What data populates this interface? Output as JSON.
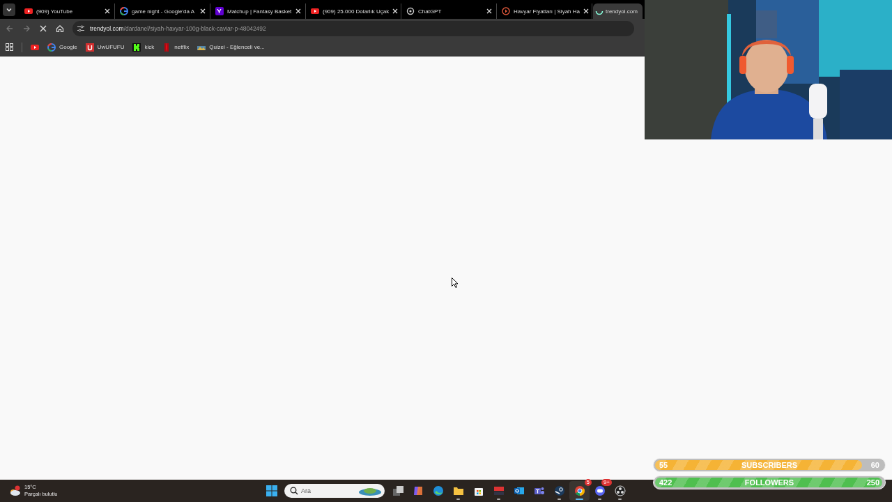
{
  "tabs": [
    {
      "title": "(909) YouTube",
      "kind": "youtube",
      "selected": false
    },
    {
      "title": "game night - Google'da A",
      "kind": "google",
      "selected": false
    },
    {
      "title": "Matchup | Fantasy Basket",
      "kind": "yahoo",
      "selected": false
    },
    {
      "title": "(909) 25.000 Dolarlık Uçak",
      "kind": "youtube",
      "selected": false
    },
    {
      "title": "ChatGPT",
      "kind": "chatgpt",
      "selected": false
    },
    {
      "title": "Havyar Fiyatları | Siyah Ha",
      "kind": "ring",
      "selected": false
    },
    {
      "title": "trendyol.com",
      "kind": "loading",
      "selected": true
    }
  ],
  "address": {
    "domain": "trendyol.com",
    "path": "/dardanel/siyah-havyar-100g-black-caviar-p-48042492"
  },
  "bookmarks": [
    {
      "kind": "youtube"
    },
    {
      "label": "Google",
      "kind": "google"
    },
    {
      "label": "UwUFUFU",
      "kind": "uwu"
    },
    {
      "label": "kick",
      "kind": "kick"
    },
    {
      "label": "netflix",
      "kind": "netflix"
    },
    {
      "label": "Quizei - Eğlenceli ve...",
      "kind": "quiz"
    }
  ],
  "taskbar": {
    "weather": {
      "temp": "15°C",
      "condition": "Parçalı bulutlu"
    },
    "search": {
      "placeholder": "Ara"
    },
    "apps": [
      {
        "kind": "taskview",
        "running": false,
        "active": false
      },
      {
        "kind": "copilot",
        "running": false,
        "active": false
      },
      {
        "kind": "edge",
        "running": false,
        "active": false
      },
      {
        "kind": "files",
        "running": true,
        "active": false
      },
      {
        "kind": "store",
        "running": false,
        "active": false
      },
      {
        "kind": "voicemeeter",
        "running": true,
        "active": false
      },
      {
        "kind": "outlook",
        "running": false,
        "active": false
      },
      {
        "kind": "teams",
        "running": false,
        "active": false
      },
      {
        "kind": "steam",
        "running": true,
        "active": false
      },
      {
        "kind": "chrome",
        "running": true,
        "active": true,
        "badge": "5"
      },
      {
        "kind": "discord",
        "running": true,
        "active": false,
        "badge": "9+"
      },
      {
        "kind": "obs",
        "running": true,
        "active": false
      }
    ]
  },
  "goals": [
    {
      "label": "SUBSCRIBERS",
      "current": "55",
      "target": "60",
      "level": 0.91,
      "color": "#f5b335"
    },
    {
      "label": "FOLLOWERS",
      "current": "422",
      "target": "250",
      "level": 1,
      "color": "#4fbf4f"
    }
  ]
}
